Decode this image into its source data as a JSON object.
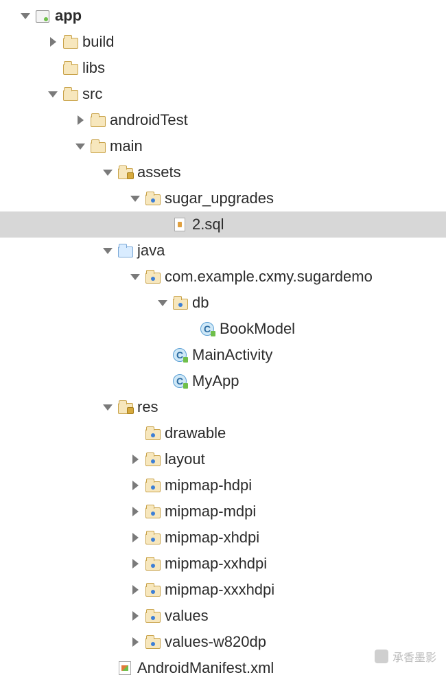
{
  "indentUnit": 40,
  "baseIndent": 30,
  "watermark": "承香墨影",
  "tree": [
    {
      "depth": 0,
      "arrow": "down",
      "icon": "module",
      "label": "app",
      "bold": true,
      "selected": false
    },
    {
      "depth": 1,
      "arrow": "right",
      "icon": "folder",
      "label": "build",
      "bold": false,
      "selected": false
    },
    {
      "depth": 1,
      "arrow": "none",
      "icon": "folder",
      "label": "libs",
      "bold": false,
      "selected": false
    },
    {
      "depth": 1,
      "arrow": "down",
      "icon": "folder",
      "label": "src",
      "bold": false,
      "selected": false
    },
    {
      "depth": 2,
      "arrow": "right",
      "icon": "folder",
      "label": "androidTest",
      "bold": false,
      "selected": false
    },
    {
      "depth": 2,
      "arrow": "down",
      "icon": "folder",
      "label": "main",
      "bold": false,
      "selected": false
    },
    {
      "depth": 3,
      "arrow": "down",
      "icon": "folder-res",
      "label": "assets",
      "bold": false,
      "selected": false
    },
    {
      "depth": 4,
      "arrow": "down",
      "icon": "folder-pkg",
      "label": "sugar_upgrades",
      "bold": false,
      "selected": false
    },
    {
      "depth": 5,
      "arrow": "none",
      "icon": "file-db",
      "label": "2.sql",
      "bold": false,
      "selected": true
    },
    {
      "depth": 3,
      "arrow": "down",
      "icon": "folder-java",
      "label": "java",
      "bold": false,
      "selected": false
    },
    {
      "depth": 4,
      "arrow": "down",
      "icon": "folder-pkg",
      "label": "com.example.cxmy.sugardemo",
      "bold": false,
      "selected": false
    },
    {
      "depth": 5,
      "arrow": "down",
      "icon": "folder-pkg",
      "label": "db",
      "bold": false,
      "selected": false
    },
    {
      "depth": 6,
      "arrow": "none",
      "icon": "class",
      "label": "BookModel",
      "bold": false,
      "selected": false
    },
    {
      "depth": 5,
      "arrow": "none",
      "icon": "class",
      "label": "MainActivity",
      "bold": false,
      "selected": false
    },
    {
      "depth": 5,
      "arrow": "none",
      "icon": "class",
      "label": "MyApp",
      "bold": false,
      "selected": false
    },
    {
      "depth": 3,
      "arrow": "down",
      "icon": "folder-res",
      "label": "res",
      "bold": false,
      "selected": false
    },
    {
      "depth": 4,
      "arrow": "none",
      "icon": "folder-pkg",
      "label": "drawable",
      "bold": false,
      "selected": false
    },
    {
      "depth": 4,
      "arrow": "right",
      "icon": "folder-pkg",
      "label": "layout",
      "bold": false,
      "selected": false
    },
    {
      "depth": 4,
      "arrow": "right",
      "icon": "folder-pkg",
      "label": "mipmap-hdpi",
      "bold": false,
      "selected": false
    },
    {
      "depth": 4,
      "arrow": "right",
      "icon": "folder-pkg",
      "label": "mipmap-mdpi",
      "bold": false,
      "selected": false
    },
    {
      "depth": 4,
      "arrow": "right",
      "icon": "folder-pkg",
      "label": "mipmap-xhdpi",
      "bold": false,
      "selected": false
    },
    {
      "depth": 4,
      "arrow": "right",
      "icon": "folder-pkg",
      "label": "mipmap-xxhdpi",
      "bold": false,
      "selected": false
    },
    {
      "depth": 4,
      "arrow": "right",
      "icon": "folder-pkg",
      "label": "mipmap-xxxhdpi",
      "bold": false,
      "selected": false
    },
    {
      "depth": 4,
      "arrow": "right",
      "icon": "folder-pkg",
      "label": "values",
      "bold": false,
      "selected": false
    },
    {
      "depth": 4,
      "arrow": "right",
      "icon": "folder-pkg",
      "label": "values-w820dp",
      "bold": false,
      "selected": false
    },
    {
      "depth": 3,
      "arrow": "none",
      "icon": "xml",
      "label": "AndroidManifest.xml",
      "bold": false,
      "selected": false
    }
  ]
}
